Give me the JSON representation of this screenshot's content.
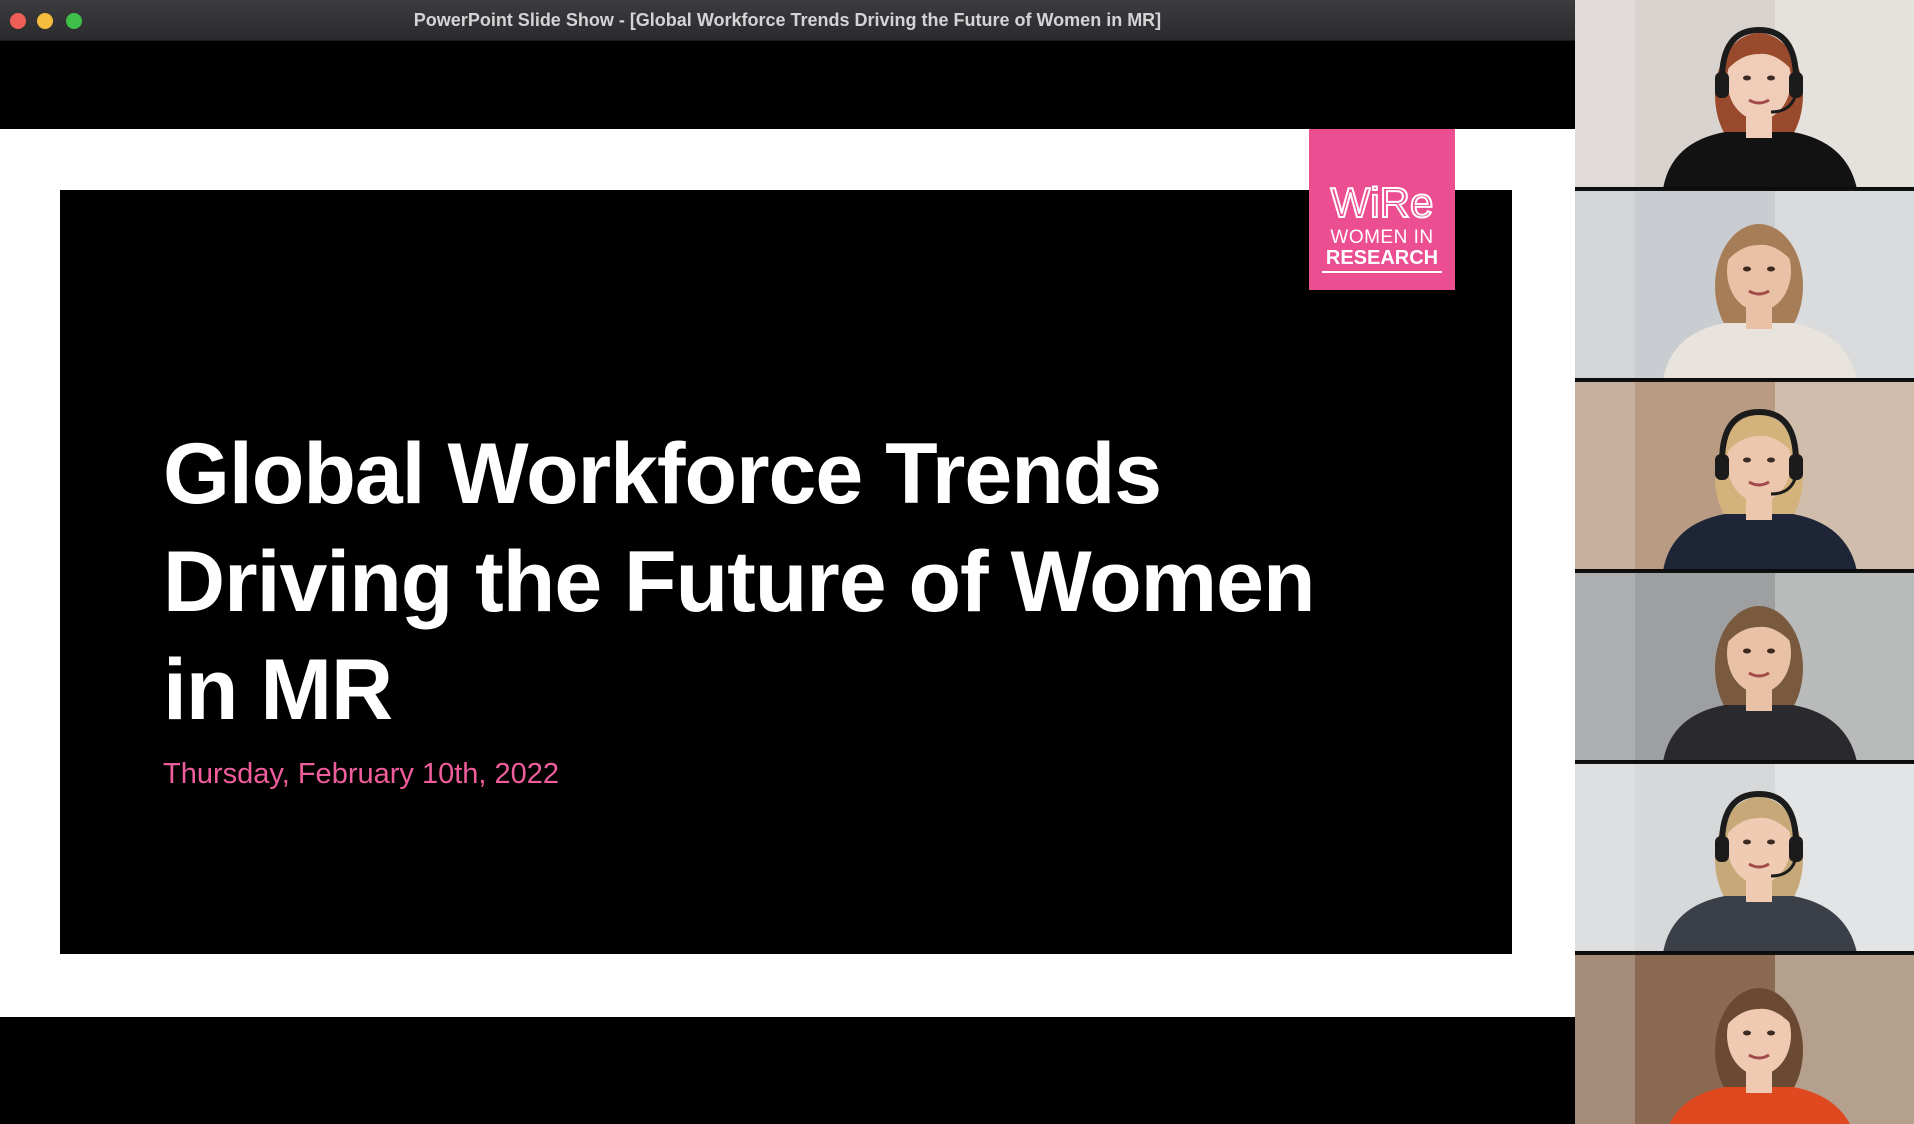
{
  "window": {
    "title": "PowerPoint Slide Show - [Global Workforce Trends Driving the Future of Women in MR]",
    "controls": [
      "close-icon",
      "minimize-icon",
      "zoom-icon"
    ]
  },
  "slide": {
    "title_lines": [
      "Global Workforce Trends",
      "Driving the Future of Women",
      "in MR"
    ],
    "subtitle": "Thursday, February 10th, 2022",
    "logo": {
      "mark": "WiRe",
      "line1": "WOMEN IN",
      "line2": "RESEARCH"
    },
    "colors": {
      "accent": "#ec4e92",
      "subtitle": "#ef5d9c",
      "background": "#000000"
    }
  },
  "participants": [
    {
      "id": 1,
      "bg": "#d9d3cf",
      "wall": "#efece9",
      "hair": "#9a4a2c",
      "skin": "#f0cdb8",
      "shirt": "#121212",
      "headset": true
    },
    {
      "id": 2,
      "bg": "#c9cdd1",
      "wall": "#e6e7e8",
      "hair": "#a67d57",
      "skin": "#e9c1a6",
      "shirt": "#e8e3dc",
      "headset": false
    },
    {
      "id": 3,
      "bg": "#b99b84",
      "wall": "#e3d8cc",
      "hair": "#d3b27c",
      "skin": "#ecc7ad",
      "shirt": "#1d2536",
      "headset": true
    },
    {
      "id": 4,
      "bg": "#9d9fa1",
      "wall": "#cfcfcf",
      "hair": "#7a5a3e",
      "skin": "#e8c1a7",
      "shirt": "#2a2a2e",
      "headset": false
    },
    {
      "id": 5,
      "bg": "#d6d8da",
      "wall": "#eeeeee",
      "hair": "#c7a878",
      "skin": "#efcbb3",
      "shirt": "#3a3f48",
      "headset": true
    },
    {
      "id": 6,
      "bg": "#8a6a52",
      "wall": "#d8ccc0",
      "hair": "#6b4a33",
      "skin": "#efc9b2",
      "shirt": "#e0481f",
      "headset": false
    }
  ]
}
